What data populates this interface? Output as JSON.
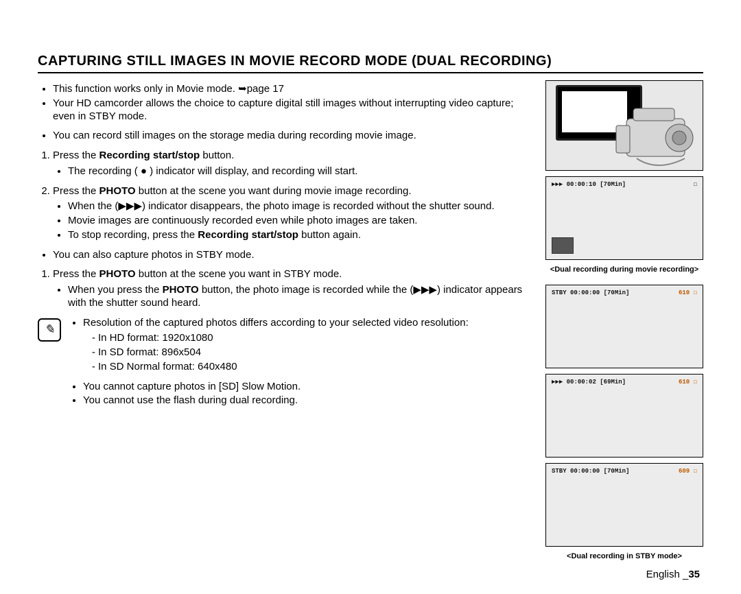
{
  "heading": "CAPTURING STILL IMAGES IN MOVIE RECORD MODE (DUAL RECORDING)",
  "intro": {
    "b1a": "This function works only in Movie mode. ",
    "b1b": "➥page 17",
    "b2": "Your HD camcorder allows the choice to capture digital still images without interrupting video capture; even in STBY mode."
  },
  "sec1": {
    "lead": "You can record still images on the storage media during recording movie image.",
    "s1a": "Press the ",
    "s1b": "Recording start/stop",
    "s1c": " button.",
    "s1sub1": "The recording ( ● ) indicator will display, and recording will start.",
    "s2a": "Press the ",
    "s2b": "PHOTO",
    "s2c": " button at the scene you want during movie image recording.",
    "s2sub1a": "When the (",
    "s2sub1b": "▶▶▶",
    "s2sub1c": ") indicator disappears, the photo image is recorded without the shutter sound.",
    "s2sub2": "Movie images are continuously recorded even while photo images are taken.",
    "s2sub3a": "To stop recording, press the ",
    "s2sub3b": "Recording start/stop",
    "s2sub3c": " button again."
  },
  "sec2": {
    "lead": "You can also capture photos in STBY mode.",
    "s1a": "Press the ",
    "s1b": "PHOTO",
    "s1c": " button at the scene you want in STBY mode.",
    "s1sub1a": "When you press the ",
    "s1sub1b": "PHOTO",
    "s1sub1c": " button, the photo image is recorded while the (",
    "s1sub1d": "▶▶▶",
    "s1sub1e": ") indicator appears with the shutter sound heard."
  },
  "note": {
    "icon": "✎",
    "b1": "Resolution of the captured photos differs according to your selected video resolution:",
    "d1": "In HD format: 1920x1080",
    "d2": "In SD format: 896x504",
    "d3": "In SD Normal format: 640x480",
    "b2": "You cannot capture photos in [SD] Slow Motion.",
    "b3": "You cannot use the flash during dual recording."
  },
  "fig": {
    "lcd1_left": "▶▶▶ 00:00:10  [70Min]",
    "lcd1_right": "☐",
    "caption1": "<Dual recording during movie recording>",
    "lcd2_left": "STBY 00:00:00  [70Min]",
    "lcd2_right": "610 ☐",
    "lcd3_left": "▶▶▶ 00:00:02  [69Min]",
    "lcd3_right": "610 ☐",
    "lcd4_left": "STBY 00:00:00  [70Min]",
    "lcd4_right": "609 ☐",
    "caption2": "<Dual recording in STBY mode>"
  },
  "footer": {
    "lang": "English _",
    "page": "35"
  }
}
